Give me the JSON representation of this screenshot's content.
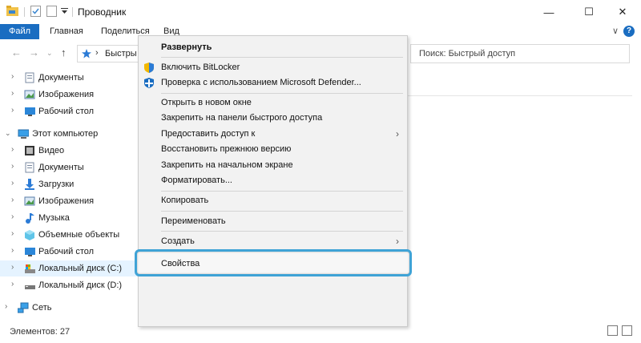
{
  "window": {
    "title": "Проводник",
    "minimize_glyph": "—",
    "maximize_glyph": "☐",
    "close_glyph": "✕"
  },
  "ribbon": {
    "tabs": [
      "Файл",
      "Главная",
      "Поделиться",
      "Вид"
    ],
    "expand_glyph": "∨",
    "help_glyph": "?"
  },
  "address": {
    "path": "Быстры",
    "search_placeholder": "Поиск: Быстрый доступ"
  },
  "nav": {
    "items": [
      {
        "label": "Документы",
        "icon": "documents-icon"
      },
      {
        "label": "Изображения",
        "icon": "pictures-icon"
      },
      {
        "label": "Рабочий стол",
        "icon": "desktop-icon"
      },
      {
        "label": "Этот компьютер",
        "icon": "computer-icon"
      },
      {
        "label": "Видео",
        "icon": "video-icon"
      },
      {
        "label": "Документы",
        "icon": "documents-icon"
      },
      {
        "label": "Загрузки",
        "icon": "downloads-icon"
      },
      {
        "label": "Изображения",
        "icon": "pictures-icon"
      },
      {
        "label": "Музыка",
        "icon": "music-icon"
      },
      {
        "label": "Объемные объекты",
        "icon": "3d-objects-icon"
      },
      {
        "label": "Рабочий стол",
        "icon": "desktop-icon"
      },
      {
        "label": "Локальный диск (C:)",
        "icon": "drive-icon"
      },
      {
        "label": "Локальный диск (D:)",
        "icon": "drive-icon"
      },
      {
        "label": "Сеть",
        "icon": "network-icon"
      }
    ],
    "selected": "Локальный диск (C:)"
  },
  "context_menu": {
    "items": [
      {
        "label": "Развернуть"
      },
      {
        "label": "Включить BitLocker"
      },
      {
        "label": "Проверка с использованием Microsoft Defender..."
      },
      {
        "label": "Открыть в новом окне"
      },
      {
        "label": "Закрепить на панели быстрого доступа"
      },
      {
        "label": "Предоставить доступ к"
      },
      {
        "label": "Восстановить прежнюю версию"
      },
      {
        "label": "Закрепить на начальном экране"
      },
      {
        "label": "Форматировать..."
      },
      {
        "label": "Копировать"
      },
      {
        "label": "Переименовать"
      },
      {
        "label": "Создать"
      },
      {
        "label": "Свойства"
      }
    ],
    "highlighted": "Свойства",
    "highlight_color": "#3fa3d6"
  },
  "status": {
    "items_count": "Элементов: 27"
  },
  "colors": {
    "accent": "#1a6dc1",
    "selection": "#e5f3ff"
  }
}
